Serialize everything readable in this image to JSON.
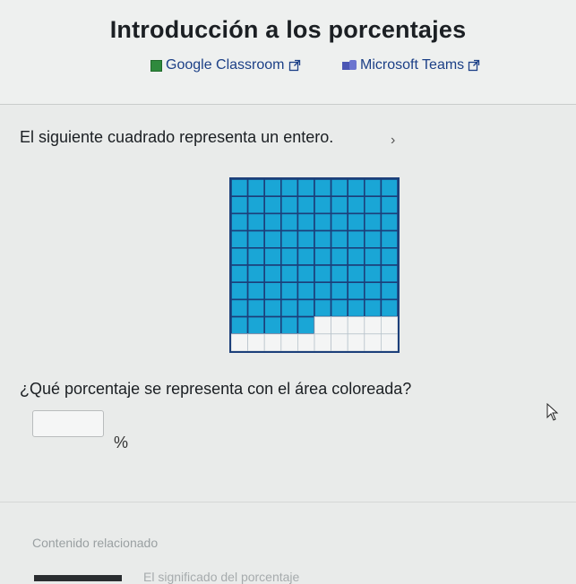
{
  "header": {
    "title": "Introducción a los porcentajes",
    "share_links": [
      {
        "label": "Google Classroom",
        "icon": "google-classroom-icon"
      },
      {
        "label": "Microsoft Teams",
        "icon": "microsoft-teams-icon"
      }
    ]
  },
  "exercise": {
    "prompt": "El siguiente cuadrado representa un entero.",
    "grid": {
      "rows": 10,
      "cols": 10,
      "shaded": 85,
      "shaded_color": "#1aa6d6",
      "unshaded_color": "#f4f5f5",
      "line_color": "#1c3f7a"
    },
    "question": "¿Qué porcentaje se representa con el área coloreada?",
    "answer": {
      "value": "",
      "unit": "%"
    }
  },
  "related": {
    "heading": "Contenido relacionado",
    "items": [
      {
        "label": "El significado del porcentaje"
      }
    ]
  }
}
